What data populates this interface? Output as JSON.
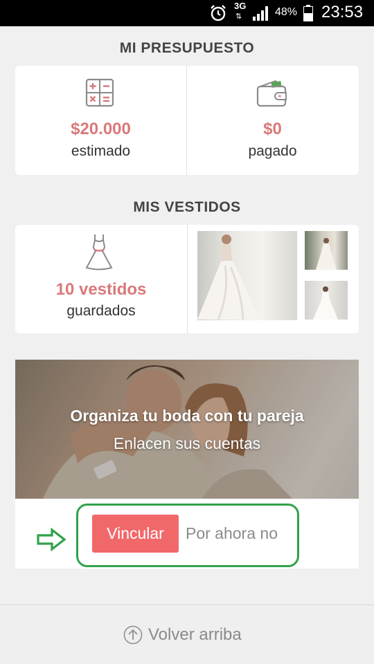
{
  "status_bar": {
    "network": "3G",
    "arrows": "⇅",
    "battery_percent": "48%",
    "time": "23:53"
  },
  "budget": {
    "title": "MI PRESUPUESTO",
    "estimated": {
      "value": "$20.000",
      "label": "estimado",
      "icon": "calculator-icon"
    },
    "paid": {
      "value": "$0",
      "label": "pagado",
      "icon": "wallet-icon"
    }
  },
  "dresses": {
    "title": "MIS VESTIDOS",
    "count": "10 vestidos",
    "label": "guardados",
    "icon": "dress-icon"
  },
  "promo": {
    "title": "Organiza tu boda con tu pareja",
    "subtitle": "Enlacen sus cuentas",
    "link_button": "Vincular",
    "later_button": "Por ahora no"
  },
  "footer": {
    "back_to_top": "Volver arriba",
    "icon": "arrow-up-circle-icon"
  },
  "colors": {
    "accent": "#d9797a",
    "button": "#f1686b",
    "highlight": "#2fa24a"
  }
}
